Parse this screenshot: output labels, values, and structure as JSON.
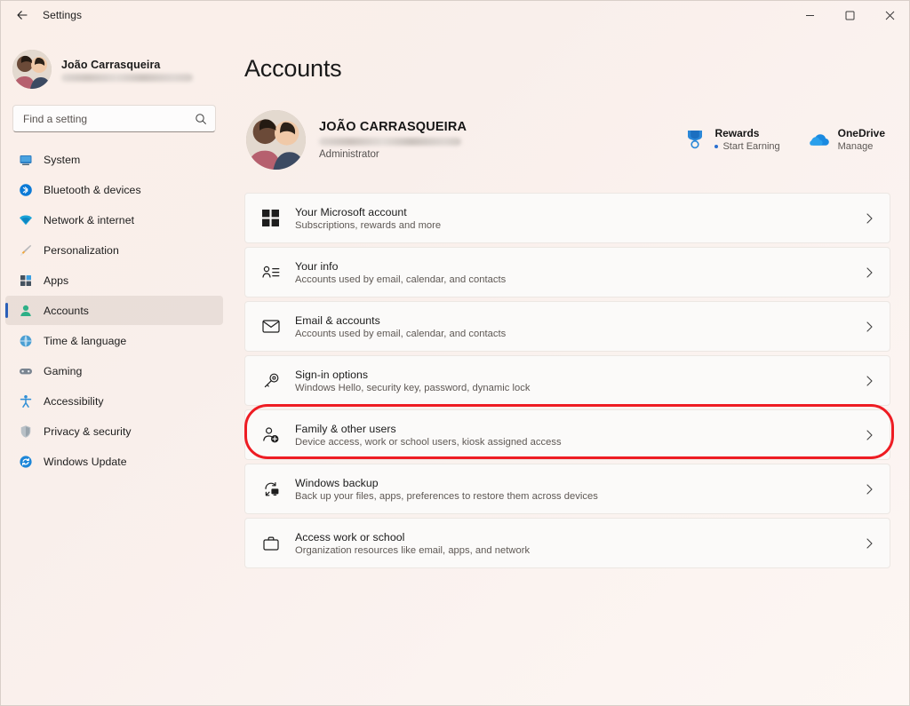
{
  "window": {
    "title": "Settings",
    "back_icon": "back-arrow-icon",
    "controls": {
      "minimize": "minimize-icon",
      "maximize": "maximize-icon",
      "close": "close-icon"
    }
  },
  "sidebar": {
    "profile": {
      "name": "João Carrasqueira",
      "email_redacted": ""
    },
    "search": {
      "placeholder": "Find a setting",
      "value": "",
      "icon": "search-icon"
    },
    "items": [
      {
        "label": "System",
        "icon": "monitor-icon",
        "selected": false
      },
      {
        "label": "Bluetooth & devices",
        "icon": "bluetooth-icon",
        "selected": false
      },
      {
        "label": "Network & internet",
        "icon": "wifi-icon",
        "selected": false
      },
      {
        "label": "Personalization",
        "icon": "paintbrush-icon",
        "selected": false
      },
      {
        "label": "Apps",
        "icon": "apps-grid-icon",
        "selected": false
      },
      {
        "label": "Accounts",
        "icon": "person-icon",
        "selected": true
      },
      {
        "label": "Time & language",
        "icon": "clock-globe-icon",
        "selected": false
      },
      {
        "label": "Gaming",
        "icon": "gamepad-icon",
        "selected": false
      },
      {
        "label": "Accessibility",
        "icon": "accessibility-person-icon",
        "selected": false
      },
      {
        "label": "Privacy & security",
        "icon": "shield-icon",
        "selected": false
      },
      {
        "label": "Windows Update",
        "icon": "update-refresh-icon",
        "selected": false
      }
    ]
  },
  "main": {
    "page_title": "Accounts",
    "account": {
      "name": "JOÃO CARRASQUEIRA",
      "email_redacted": "",
      "role": "Administrator"
    },
    "header_actions": [
      {
        "title": "Rewards",
        "subtitle": "Start Earning",
        "icon": "rewards-medal-icon",
        "has_dot": true
      },
      {
        "title": "OneDrive",
        "subtitle": "Manage",
        "icon": "onedrive-cloud-icon",
        "has_dot": false
      }
    ],
    "cards": [
      {
        "title": "Your Microsoft account",
        "subtitle": "Subscriptions, rewards and more",
        "icon": "microsoft-logo-icon",
        "chevron": "chevron-right-icon",
        "highlighted": false
      },
      {
        "title": "Your info",
        "subtitle": "Accounts used by email, calendar, and contacts",
        "icon": "person-details-icon",
        "chevron": "chevron-right-icon",
        "highlighted": false
      },
      {
        "title": "Email & accounts",
        "subtitle": "Accounts used by email, calendar, and contacts",
        "icon": "envelope-icon",
        "chevron": "chevron-right-icon",
        "highlighted": false
      },
      {
        "title": "Sign-in options",
        "subtitle": "Windows Hello, security key, password, dynamic lock",
        "icon": "key-icon",
        "chevron": "chevron-right-icon",
        "highlighted": false
      },
      {
        "title": "Family & other users",
        "subtitle": "Device access, work or school users, kiosk assigned access",
        "icon": "person-add-icon",
        "chevron": "chevron-right-icon",
        "highlighted": true
      },
      {
        "title": "Windows backup",
        "subtitle": "Back up your files, apps, preferences to restore them across devices",
        "icon": "backup-sync-icon",
        "chevron": "chevron-right-icon",
        "highlighted": false
      },
      {
        "title": "Access work or school",
        "subtitle": "Organization resources like email, apps, and network",
        "icon": "briefcase-icon",
        "chevron": "chevron-right-icon",
        "highlighted": false
      }
    ]
  },
  "annotation": {
    "highlight_color": "#ee1c23",
    "target": "Family & other users"
  },
  "colors": {
    "page_background": "#faefe9",
    "card_background": "#fbfaf9",
    "accent_selected": "#2b5fb8",
    "text_primary": "#1a1a1a",
    "text_secondary": "#5e5854"
  }
}
